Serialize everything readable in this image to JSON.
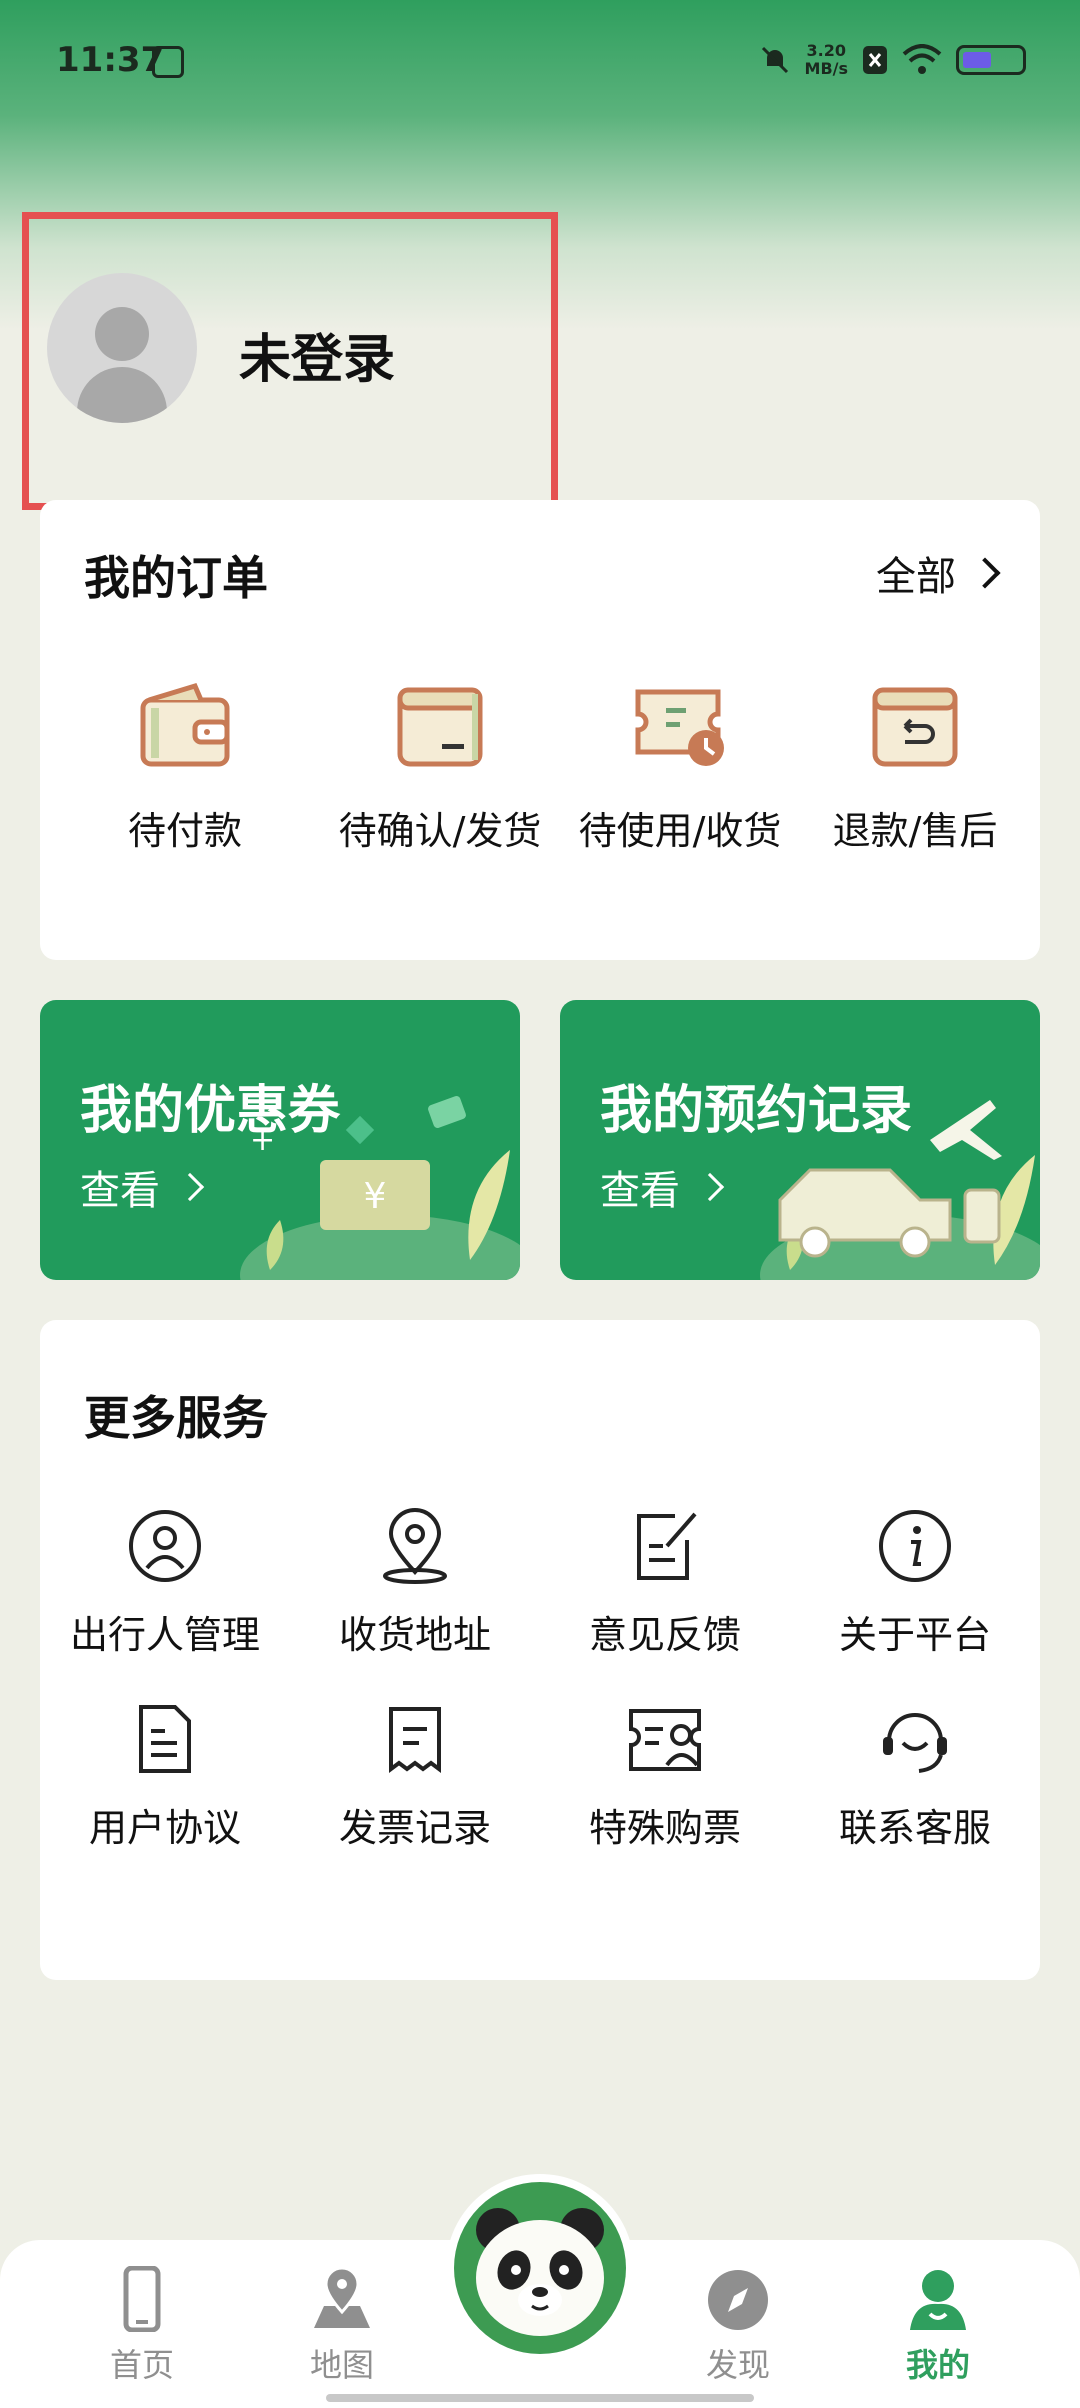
{
  "status_bar": {
    "time": "11:37",
    "net_speed_value": "3.20",
    "net_speed_unit": "MB/s"
  },
  "profile": {
    "name": "未登录"
  },
  "orders": {
    "title": "我的订单",
    "all_label": "全部",
    "items": [
      {
        "label": "待付款",
        "icon": "wallet-icon"
      },
      {
        "label": "待确认/发货",
        "icon": "box-icon"
      },
      {
        "label": "待使用/收货",
        "icon": "ticket-clock-icon"
      },
      {
        "label": "退款/售后",
        "icon": "return-box-icon"
      }
    ]
  },
  "promos": [
    {
      "title": "我的优惠券",
      "action": "查看",
      "icon": "coupon-illustration"
    },
    {
      "title": "我的预约记录",
      "action": "查看",
      "icon": "car-illustration"
    }
  ],
  "services": {
    "title": "更多服务",
    "items": [
      {
        "label": "出行人管理",
        "icon": "traveler-icon"
      },
      {
        "label": "收货地址",
        "icon": "location-icon"
      },
      {
        "label": "意见反馈",
        "icon": "feedback-icon"
      },
      {
        "label": "关于平台",
        "icon": "info-icon"
      },
      {
        "label": "用户协议",
        "icon": "document-icon"
      },
      {
        "label": "发票记录",
        "icon": "invoice-icon"
      },
      {
        "label": "特殊购票",
        "icon": "special-ticket-icon"
      },
      {
        "label": "联系客服",
        "icon": "headset-icon"
      }
    ]
  },
  "tabbar": {
    "items": [
      {
        "label": "首页",
        "icon": "phone-icon"
      },
      {
        "label": "地图",
        "icon": "map-icon"
      },
      {
        "label": "发现",
        "icon": "compass-icon"
      },
      {
        "label": "我的",
        "icon": "user-icon",
        "active": true
      }
    ],
    "center_icon": "panda-icon"
  },
  "colors": {
    "accent": "#2f9f5e",
    "promo_bg": "#219b5c",
    "highlight_border": "#e55050",
    "order_icon": "#c77a55"
  }
}
